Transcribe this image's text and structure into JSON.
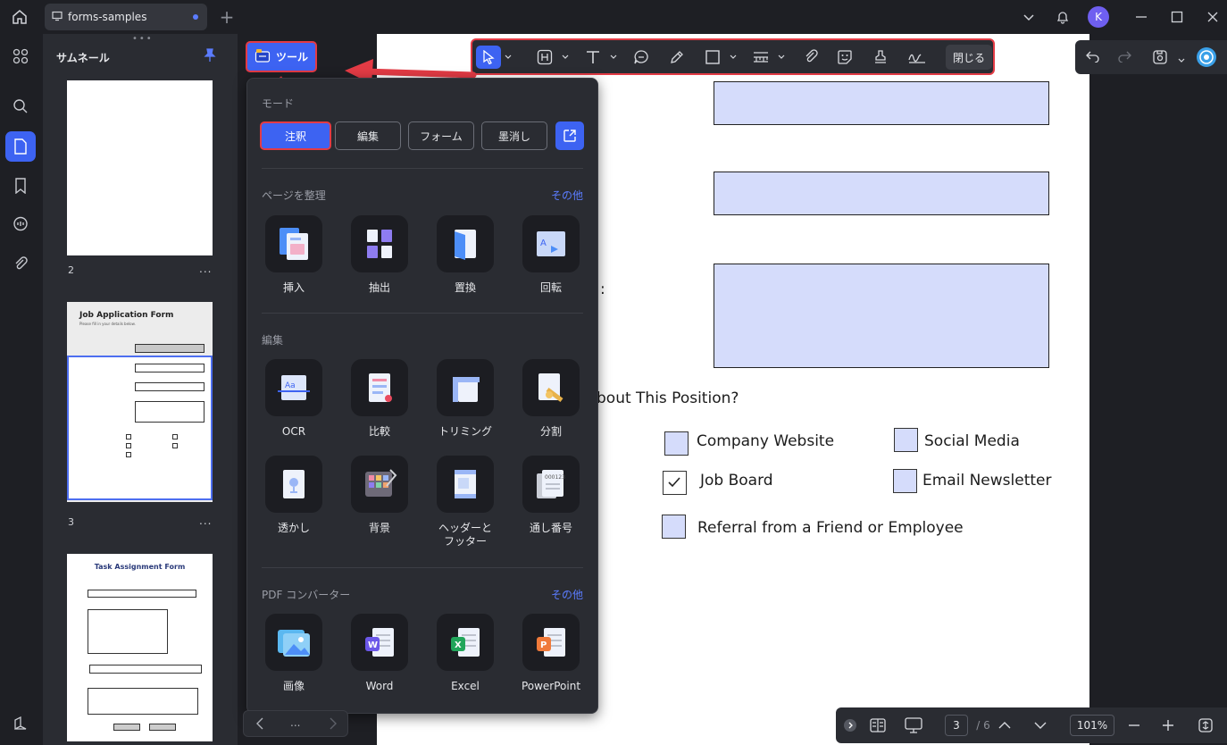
{
  "titlebar": {
    "tab_title": "forms-samples",
    "avatar_letter": "K"
  },
  "thumbnails": {
    "title": "サムネール",
    "pages": [
      {
        "number": "2"
      },
      {
        "number": "3",
        "form_title": "Job Application Form",
        "form_subtitle": "Please fill in your details below."
      },
      {
        "form_title": "Task Assignment Form"
      }
    ],
    "more": "..."
  },
  "tools_button": {
    "label": "ツール"
  },
  "toolbar": {
    "close_label": "閉じる"
  },
  "popup": {
    "mode": {
      "title": "モード",
      "buttons": [
        "注釈",
        "編集",
        "フォーム",
        "墨消し"
      ]
    },
    "organize": {
      "title": "ページを整理",
      "more": "その他",
      "items": [
        "挿入",
        "抽出",
        "置換",
        "回転"
      ]
    },
    "edit": {
      "title": "編集",
      "items": [
        "OCR",
        "比較",
        "トリミング",
        "分割"
      ]
    },
    "edit2": {
      "items": [
        "透かし",
        "背景",
        "ヘッダーと\nフッター",
        "通し番号"
      ]
    },
    "converter": {
      "title": "PDF コンバーター",
      "more": "その他",
      "items": [
        "画像",
        "Word",
        "Excel",
        "PowerPoint"
      ]
    }
  },
  "document": {
    "partial_label": ":",
    "question_fragment": "bout This Position?",
    "options": [
      "Company Website",
      "Social Media",
      "Job Board",
      "Email Newsletter",
      "Referral from a Friend or Employee"
    ],
    "checked": [
      false,
      false,
      true,
      false,
      false
    ]
  },
  "bottombar": {
    "page_current": "3",
    "page_total": "/ 6",
    "zoom": "101%"
  },
  "pager": {
    "dots": "..."
  },
  "colors": {
    "accent": "#3d63f2",
    "highlight_border": "#e33b45",
    "field_fill": "#d5dcfb"
  }
}
